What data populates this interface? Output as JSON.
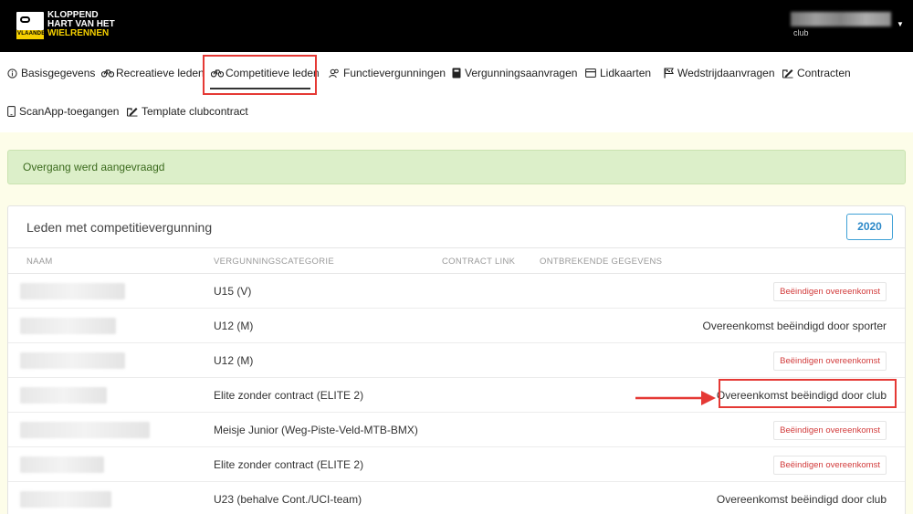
{
  "brand": {
    "line1": "KLOPPEND",
    "line2": "HART VAN HET",
    "line3": "WIELRENNEN",
    "badge_text": "CYCLING",
    "badge_subtext": "VLAANDEREN"
  },
  "user": {
    "role": "club"
  },
  "nav": [
    {
      "id": "basisgegevens",
      "label": "Basisgegevens",
      "icon": "info-circle-icon"
    },
    {
      "id": "recreatieve-leden",
      "label": "Recreatieve leden",
      "icon": "bicycle-icon"
    },
    {
      "id": "competitieve-leden",
      "label": "Competitieve leden",
      "icon": "bicycle-icon",
      "active": true
    },
    {
      "id": "functievergunningen",
      "label": "Functievergunningen",
      "icon": "users-icon"
    },
    {
      "id": "vergunningsaanvragen",
      "label": "Vergunningsaanvragen",
      "icon": "book-icon"
    },
    {
      "id": "lidkaarten",
      "label": "Lidkaarten",
      "icon": "card-icon"
    },
    {
      "id": "wedstrijdaanvragen",
      "label": "Wedstrijdaanvragen",
      "icon": "flag-icon"
    },
    {
      "id": "contracten",
      "label": "Contracten",
      "icon": "signature-icon"
    },
    {
      "id": "scanapp",
      "label": "ScanApp-toegangen",
      "icon": "phone-icon"
    },
    {
      "id": "template",
      "label": "Template clubcontract",
      "icon": "signature-icon"
    }
  ],
  "alert": {
    "message": "Overgang werd aangevraagd"
  },
  "card": {
    "title": "Leden met competitievergunning",
    "year": "2020",
    "columns": {
      "naam": "NAAM",
      "categorie": "VERGUNNINGSCATEGORIE",
      "contract_link": "CONTRACT LINK",
      "ontbrekend": "ONTBREKENDE GEGEVENS"
    },
    "rows": [
      {
        "category": "U15 (V)",
        "action": "Beëindigen overeenkomst"
      },
      {
        "category": "U12 (M)",
        "status": "Overeenkomst beëindigd door sporter"
      },
      {
        "category": "U12 (M)",
        "action": "Beëindigen overeenkomst"
      },
      {
        "category": "Elite zonder contract (ELITE 2)",
        "status": "Overeenkomst beëindigd door club"
      },
      {
        "category": "Meisje Junior (Weg-Piste-Veld-MTB-BMX)",
        "action": "Beëindigen overeenkomst"
      },
      {
        "category": "Elite zonder contract (ELITE 2)",
        "action": "Beëindigen overeenkomst"
      },
      {
        "category": "U23 (behalve Cont./UCI-team)",
        "status": "Overeenkomst beëindigd door club"
      }
    ]
  },
  "colors": {
    "accent": "#2b88c8",
    "danger": "#d23b3b",
    "highlight": "#e53935",
    "alert_bg": "#dcefc9"
  }
}
